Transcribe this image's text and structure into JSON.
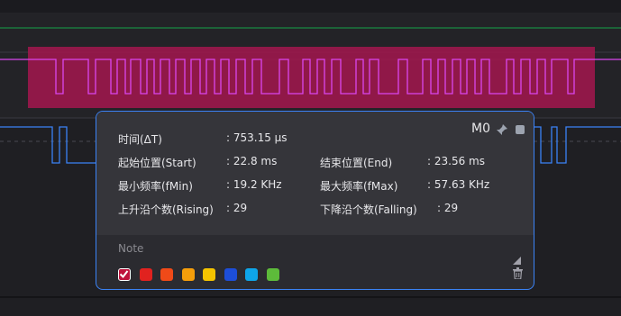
{
  "marker": {
    "name": "M0",
    "rows": [
      {
        "label": "时间(ΔT)",
        "value": ": 753.15 µs"
      },
      {
        "label": "起始位置(Start)",
        "value": ": 22.8 ms"
      },
      {
        "label": "结束位置(End)",
        "value": ": 23.56 ms"
      },
      {
        "label": "最小频率(fMin)",
        "value": ": 19.2 KHz"
      },
      {
        "label": "最大频率(fMax)",
        "value": ": 57.63 KHz"
      },
      {
        "label": "上升沿个数(Rising)",
        "value": ": 29"
      },
      {
        "label": "下降沿个数(Falling)",
        "value": ": 29"
      }
    ],
    "note_placeholder": "Note",
    "colors": [
      "#ffffff",
      "#e1221f",
      "#f04a18",
      "#f59e0b",
      "#f5c400",
      "#1d4ed8",
      "#0ea5e9",
      "#5dbb3a"
    ],
    "selected_color": "#ffffff"
  },
  "waveform": {
    "top_line_color": "#22c55e",
    "selection_color": "#a3164f",
    "channel2_color": "#c026d3",
    "channel3_color": "#3b82f6"
  }
}
